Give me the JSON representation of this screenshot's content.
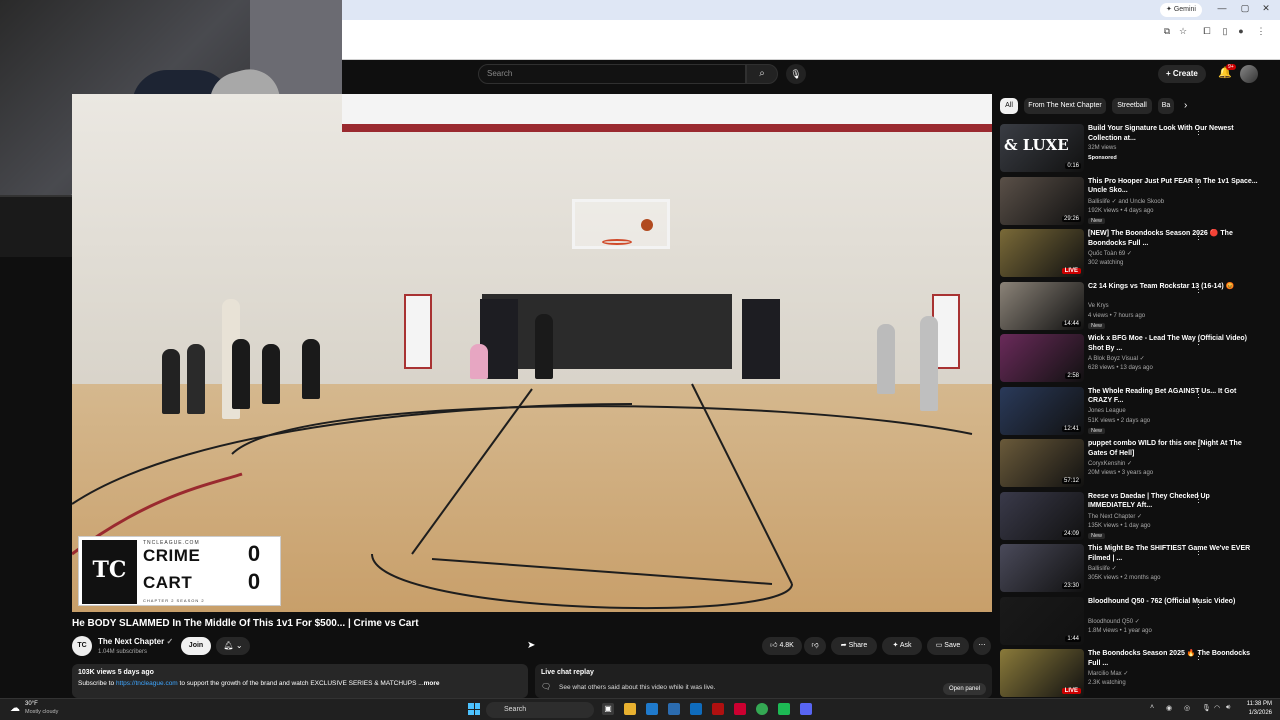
{
  "browser": {
    "gemini_label": "Gemini",
    "minimize": "—",
    "maximize": "▢",
    "close": "✕"
  },
  "header": {
    "search_placeholder": "Search",
    "create_label": "Create",
    "notif_count": "9+"
  },
  "video": {
    "title": "He BODY SLAMMED In The Middle Of This 1v1 For $500... | Crime vs Cart",
    "scoreboard": {
      "site": "TNCLEAGUE.COM",
      "team1": "CRIME",
      "team2": "CART",
      "score1": "0",
      "score2": "0",
      "season": "CHAPTER 2 SEASON 2"
    }
  },
  "channel": {
    "name": "The Next Chapter",
    "subs": "1.04M subscribers",
    "join_label": "Join"
  },
  "actions": {
    "likes": "4.8K",
    "share": "Share",
    "ask": "Ask",
    "save": "Save"
  },
  "description": {
    "meta": "103K views  5 days ago",
    "text_before": "Subscribe to ",
    "link": "https://tncleague.com",
    "text_after": " to support the growth of the brand and watch EXCLUSIVE SERIES & MATCHUPS ...",
    "more": "more"
  },
  "live_chat": {
    "title": "Live chat replay",
    "subtitle": "See what others said about this video while it was live.",
    "open_panel": "Open panel"
  },
  "chips": [
    "All",
    "From The Next Chapter",
    "Streetball",
    "Ba"
  ],
  "recommendations": [
    {
      "title": "Build Your Signature Look With Our Newest Collection at...",
      "channel": "",
      "meta": "32M views",
      "badge": "Sponsored",
      "duration": "0:16",
      "thumb_text": "& LUXE",
      "color": "#3a3d44"
    },
    {
      "title": "This Pro Hooper Just Put FEAR In The 1v1 Space... Uncle Sko...",
      "channel": "Ballislife ✓ and Uncle Skoob",
      "meta": "192K views • 4 days ago",
      "badge": "New",
      "duration": "29:26",
      "thumb_text": "",
      "color": "#5a5048"
    },
    {
      "title": "[NEW] The Boondocks Season 2026 🔴 The Boondocks Full ...",
      "channel": "Quốc Toàn 69 ✓",
      "meta": "302 watching",
      "badge": "",
      "duration": "LIVE",
      "thumb_text": "",
      "color": "#7a6a38"
    },
    {
      "title": "C2 14 Kings vs Team Rockstar 13 (16-14) 😡",
      "channel": "Ve Krys",
      "meta": "4 views • 7 hours ago",
      "badge": "New",
      "duration": "14:44",
      "thumb_text": "",
      "color": "#8b8378"
    },
    {
      "title": "Wick x BFG Moe - Lead The Way (Official Video) Shot By ...",
      "channel": "A Blok Boyz Visual ✓",
      "meta": "628 views • 13 days ago",
      "badge": "",
      "duration": "2:58",
      "thumb_text": "",
      "color": "#6a2a5a"
    },
    {
      "title": "The Whole Reading Bet AGAINST Us... It Got CRAZY F...",
      "channel": "Jones League",
      "meta": "51K views • 2 days ago",
      "badge": "New",
      "duration": "12:41",
      "thumb_text": "",
      "color": "#2a3a5a"
    },
    {
      "title": "puppet combo WILD for this one [Night At The Gates Of Hell]",
      "channel": "CoryxKenshin ✓",
      "meta": "20M views • 3 years ago",
      "badge": "",
      "duration": "57:12",
      "thumb_text": "",
      "color": "#6a5a3a"
    },
    {
      "title": "Reese vs Daedae | They Checked Up IMMEDIATELY Aft...",
      "channel": "The Next Chapter ✓",
      "meta": "135K views • 1 day ago",
      "badge": "New",
      "duration": "24:09",
      "thumb_text": "",
      "color": "#3a3a4a"
    },
    {
      "title": "This Might Be The SHIFTIEST Game We've EVER Filmed | ...",
      "channel": "Ballislife ✓",
      "meta": "305K views • 2 months ago",
      "badge": "",
      "duration": "23:30",
      "thumb_text": "",
      "color": "#4a4a5a"
    },
    {
      "title": "Bloodhound Q50 - 762 (Official Music Video)",
      "channel": "Bloodhound Q50 ✓",
      "meta": "1.8M views • 1 year ago",
      "badge": "",
      "duration": "1:44",
      "thumb_text": "",
      "color": "#1a1a1a"
    },
    {
      "title": "The Boondocks Season 2025 🔥 The Boondocks Full ...",
      "channel": "Marcilio Max ✓",
      "meta": "2.3K watching",
      "badge": "",
      "duration": "LIVE",
      "thumb_text": "",
      "color": "#8a7a3a"
    }
  ],
  "taskbar": {
    "temp": "30°F",
    "condition": "Mostly cloudy",
    "search": "Search",
    "time": "11:38 PM",
    "date": "1/3/2026"
  }
}
